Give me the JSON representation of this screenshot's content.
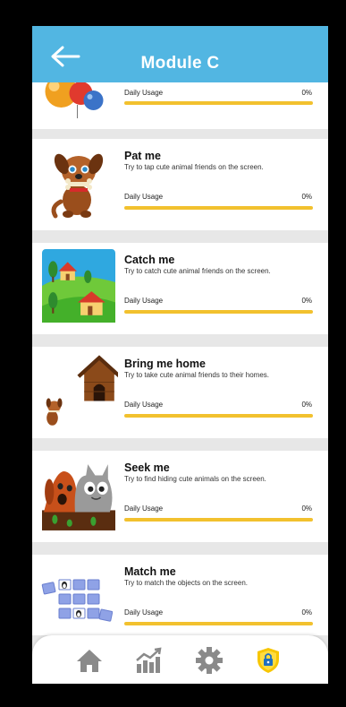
{
  "header": {
    "title": "Module C"
  },
  "modules": [
    {
      "name": "",
      "description": "",
      "usage_label": "Daily Usage",
      "usage_value": "0%",
      "progress": 0
    },
    {
      "name": "Pat me",
      "description": "Try to tap cute animal friends on the screen.",
      "usage_label": "Daily Usage",
      "usage_value": "0%",
      "progress": 0
    },
    {
      "name": "Catch me",
      "description": "Try to catch cute animal friends on the screen.",
      "usage_label": "Daily Usage",
      "usage_value": "0%",
      "progress": 0
    },
    {
      "name": "Bring me home",
      "description": "Try to take cute animal friends to their homes.",
      "usage_label": "Daily Usage",
      "usage_value": "0%",
      "progress": 0
    },
    {
      "name": "Seek me",
      "description": "Try to find hiding cute animals on the screen.",
      "usage_label": "Daily Usage",
      "usage_value": "0%",
      "progress": 0
    },
    {
      "name": "Match me",
      "description": "Try to match the objects on the screen.",
      "usage_label": "Daily Usage",
      "usage_value": "0%",
      "progress": 0
    }
  ],
  "nav": {
    "icons": [
      "home-icon",
      "stats-icon",
      "gear-icon",
      "shield-lock-icon"
    ],
    "accent": "#f7c600"
  },
  "colors": {
    "header": "#52b6e2",
    "progress": "#f2c12e"
  }
}
